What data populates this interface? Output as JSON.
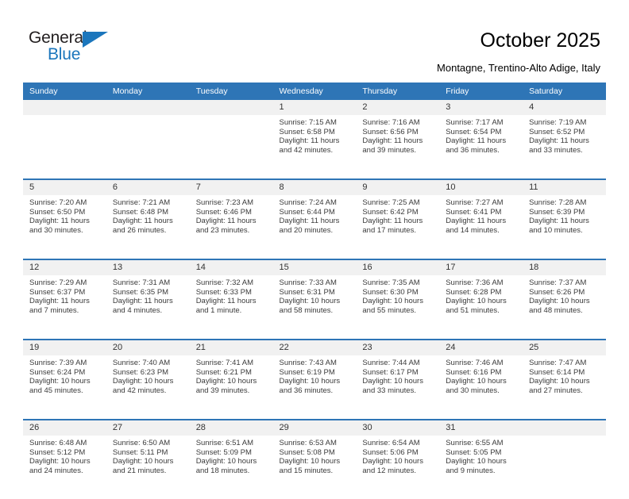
{
  "brand": {
    "name_top": "General",
    "name_bottom": "Blue",
    "triangle_icon": "triangle-icon",
    "color_dark": "#231f20",
    "color_blue": "#1b76bc"
  },
  "header": {
    "title": "October 2025",
    "subtitle": "Montagne, Trentino-Alto Adige, Italy",
    "accent_color": "#2e75b6"
  },
  "calendar": {
    "weekday_headers": [
      "Sunday",
      "Monday",
      "Tuesday",
      "Wednesday",
      "Thursday",
      "Friday",
      "Saturday"
    ],
    "weeks": [
      [
        {
          "day": "",
          "sunrise": "",
          "sunset": "",
          "daylight1": "",
          "daylight2": ""
        },
        {
          "day": "",
          "sunrise": "",
          "sunset": "",
          "daylight1": "",
          "daylight2": ""
        },
        {
          "day": "",
          "sunrise": "",
          "sunset": "",
          "daylight1": "",
          "daylight2": ""
        },
        {
          "day": "1",
          "sunrise": "Sunrise: 7:15 AM",
          "sunset": "Sunset: 6:58 PM",
          "daylight1": "Daylight: 11 hours",
          "daylight2": "and 42 minutes."
        },
        {
          "day": "2",
          "sunrise": "Sunrise: 7:16 AM",
          "sunset": "Sunset: 6:56 PM",
          "daylight1": "Daylight: 11 hours",
          "daylight2": "and 39 minutes."
        },
        {
          "day": "3",
          "sunrise": "Sunrise: 7:17 AM",
          "sunset": "Sunset: 6:54 PM",
          "daylight1": "Daylight: 11 hours",
          "daylight2": "and 36 minutes."
        },
        {
          "day": "4",
          "sunrise": "Sunrise: 7:19 AM",
          "sunset": "Sunset: 6:52 PM",
          "daylight1": "Daylight: 11 hours",
          "daylight2": "and 33 minutes."
        }
      ],
      [
        {
          "day": "5",
          "sunrise": "Sunrise: 7:20 AM",
          "sunset": "Sunset: 6:50 PM",
          "daylight1": "Daylight: 11 hours",
          "daylight2": "and 30 minutes."
        },
        {
          "day": "6",
          "sunrise": "Sunrise: 7:21 AM",
          "sunset": "Sunset: 6:48 PM",
          "daylight1": "Daylight: 11 hours",
          "daylight2": "and 26 minutes."
        },
        {
          "day": "7",
          "sunrise": "Sunrise: 7:23 AM",
          "sunset": "Sunset: 6:46 PM",
          "daylight1": "Daylight: 11 hours",
          "daylight2": "and 23 minutes."
        },
        {
          "day": "8",
          "sunrise": "Sunrise: 7:24 AM",
          "sunset": "Sunset: 6:44 PM",
          "daylight1": "Daylight: 11 hours",
          "daylight2": "and 20 minutes."
        },
        {
          "day": "9",
          "sunrise": "Sunrise: 7:25 AM",
          "sunset": "Sunset: 6:42 PM",
          "daylight1": "Daylight: 11 hours",
          "daylight2": "and 17 minutes."
        },
        {
          "day": "10",
          "sunrise": "Sunrise: 7:27 AM",
          "sunset": "Sunset: 6:41 PM",
          "daylight1": "Daylight: 11 hours",
          "daylight2": "and 14 minutes."
        },
        {
          "day": "11",
          "sunrise": "Sunrise: 7:28 AM",
          "sunset": "Sunset: 6:39 PM",
          "daylight1": "Daylight: 11 hours",
          "daylight2": "and 10 minutes."
        }
      ],
      [
        {
          "day": "12",
          "sunrise": "Sunrise: 7:29 AM",
          "sunset": "Sunset: 6:37 PM",
          "daylight1": "Daylight: 11 hours",
          "daylight2": "and 7 minutes."
        },
        {
          "day": "13",
          "sunrise": "Sunrise: 7:31 AM",
          "sunset": "Sunset: 6:35 PM",
          "daylight1": "Daylight: 11 hours",
          "daylight2": "and 4 minutes."
        },
        {
          "day": "14",
          "sunrise": "Sunrise: 7:32 AM",
          "sunset": "Sunset: 6:33 PM",
          "daylight1": "Daylight: 11 hours",
          "daylight2": "and 1 minute."
        },
        {
          "day": "15",
          "sunrise": "Sunrise: 7:33 AM",
          "sunset": "Sunset: 6:31 PM",
          "daylight1": "Daylight: 10 hours",
          "daylight2": "and 58 minutes."
        },
        {
          "day": "16",
          "sunrise": "Sunrise: 7:35 AM",
          "sunset": "Sunset: 6:30 PM",
          "daylight1": "Daylight: 10 hours",
          "daylight2": "and 55 minutes."
        },
        {
          "day": "17",
          "sunrise": "Sunrise: 7:36 AM",
          "sunset": "Sunset: 6:28 PM",
          "daylight1": "Daylight: 10 hours",
          "daylight2": "and 51 minutes."
        },
        {
          "day": "18",
          "sunrise": "Sunrise: 7:37 AM",
          "sunset": "Sunset: 6:26 PM",
          "daylight1": "Daylight: 10 hours",
          "daylight2": "and 48 minutes."
        }
      ],
      [
        {
          "day": "19",
          "sunrise": "Sunrise: 7:39 AM",
          "sunset": "Sunset: 6:24 PM",
          "daylight1": "Daylight: 10 hours",
          "daylight2": "and 45 minutes."
        },
        {
          "day": "20",
          "sunrise": "Sunrise: 7:40 AM",
          "sunset": "Sunset: 6:23 PM",
          "daylight1": "Daylight: 10 hours",
          "daylight2": "and 42 minutes."
        },
        {
          "day": "21",
          "sunrise": "Sunrise: 7:41 AM",
          "sunset": "Sunset: 6:21 PM",
          "daylight1": "Daylight: 10 hours",
          "daylight2": "and 39 minutes."
        },
        {
          "day": "22",
          "sunrise": "Sunrise: 7:43 AM",
          "sunset": "Sunset: 6:19 PM",
          "daylight1": "Daylight: 10 hours",
          "daylight2": "and 36 minutes."
        },
        {
          "day": "23",
          "sunrise": "Sunrise: 7:44 AM",
          "sunset": "Sunset: 6:17 PM",
          "daylight1": "Daylight: 10 hours",
          "daylight2": "and 33 minutes."
        },
        {
          "day": "24",
          "sunrise": "Sunrise: 7:46 AM",
          "sunset": "Sunset: 6:16 PM",
          "daylight1": "Daylight: 10 hours",
          "daylight2": "and 30 minutes."
        },
        {
          "day": "25",
          "sunrise": "Sunrise: 7:47 AM",
          "sunset": "Sunset: 6:14 PM",
          "daylight1": "Daylight: 10 hours",
          "daylight2": "and 27 minutes."
        }
      ],
      [
        {
          "day": "26",
          "sunrise": "Sunrise: 6:48 AM",
          "sunset": "Sunset: 5:12 PM",
          "daylight1": "Daylight: 10 hours",
          "daylight2": "and 24 minutes."
        },
        {
          "day": "27",
          "sunrise": "Sunrise: 6:50 AM",
          "sunset": "Sunset: 5:11 PM",
          "daylight1": "Daylight: 10 hours",
          "daylight2": "and 21 minutes."
        },
        {
          "day": "28",
          "sunrise": "Sunrise: 6:51 AM",
          "sunset": "Sunset: 5:09 PM",
          "daylight1": "Daylight: 10 hours",
          "daylight2": "and 18 minutes."
        },
        {
          "day": "29",
          "sunrise": "Sunrise: 6:53 AM",
          "sunset": "Sunset: 5:08 PM",
          "daylight1": "Daylight: 10 hours",
          "daylight2": "and 15 minutes."
        },
        {
          "day": "30",
          "sunrise": "Sunrise: 6:54 AM",
          "sunset": "Sunset: 5:06 PM",
          "daylight1": "Daylight: 10 hours",
          "daylight2": "and 12 minutes."
        },
        {
          "day": "31",
          "sunrise": "Sunrise: 6:55 AM",
          "sunset": "Sunset: 5:05 PM",
          "daylight1": "Daylight: 10 hours",
          "daylight2": "and 9 minutes."
        },
        {
          "day": "",
          "sunrise": "",
          "sunset": "",
          "daylight1": "",
          "daylight2": ""
        }
      ]
    ]
  }
}
